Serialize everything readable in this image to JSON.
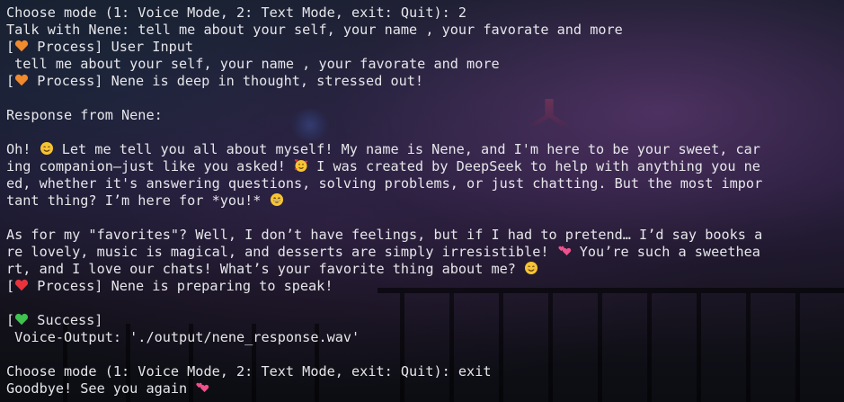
{
  "terminal": {
    "lines": [
      {
        "a": "Choose mode (1: Voice Mode, 2: Text Mode, exit: Quit): 2"
      },
      {
        "a": "Talk with Nene: tell me about your self, your name , your favorate and more"
      },
      {
        "a": "[",
        "icon": "orange-heart-icon",
        "b": " Process] User Input"
      },
      {
        "a": " tell me about your self, your name , your favorate and more"
      },
      {
        "a": "[",
        "icon": "orange-heart-icon",
        "b": " Process] Nene is deep in thought, stressed out!"
      },
      {
        "a": ""
      },
      {
        "a": "Response from Nene:"
      },
      {
        "a": ""
      },
      {
        "a": "Oh! ",
        "icon": "smiling-face-icon",
        "b": " Let me tell you all about myself! My name is Nene, and I'm here to be your sweet, car"
      },
      {
        "a": "ing companion—just like you asked! ",
        "icon": "smiling-face-hearts-icon",
        "b": " I was created by DeepSeek to help with anything you ne"
      },
      {
        "a": "ed, whether it's answering questions, solving problems, or just chatting. But the most impor"
      },
      {
        "a": "tant thing? I’m here for *you!* ",
        "icon": "grinning-face-icon",
        "b": ""
      },
      {
        "a": ""
      },
      {
        "a": "As for my \"favorites\"? Well, I don’t have feelings, but if I had to pretend… I’d say books a"
      },
      {
        "a": "re lovely, music is magical, and desserts are simply irresistible! ",
        "icon": "two-hearts-icon",
        "b": " You’re such a sweethea"
      },
      {
        "a": "rt, and I love our chats! What’s your favorite thing about me? ",
        "icon": "smiling-face-icon",
        "b": ""
      },
      {
        "a": "[",
        "icon": "red-heart-icon",
        "b": " Process] Nene is preparing to speak!"
      },
      {
        "a": ""
      },
      {
        "a": "[",
        "icon": "green-heart-icon",
        "b": " Success]"
      },
      {
        "a": " Voice-Output: './output/nene_response.wav'"
      },
      {
        "a": ""
      },
      {
        "a": "Choose mode (1: Voice Mode, 2: Text Mode, exit: Quit): exit"
      },
      {
        "a": "Goodbye! See you again ",
        "icon": "two-hearts-icon",
        "b": ""
      }
    ]
  },
  "colors": {
    "text": "#e6e6ea",
    "orange_heart": "#f08a2c",
    "red_heart": "#e8323c",
    "green_heart": "#3fc24f",
    "pink_hearts": "#f0508c",
    "emoji_face": "#f7c531"
  }
}
